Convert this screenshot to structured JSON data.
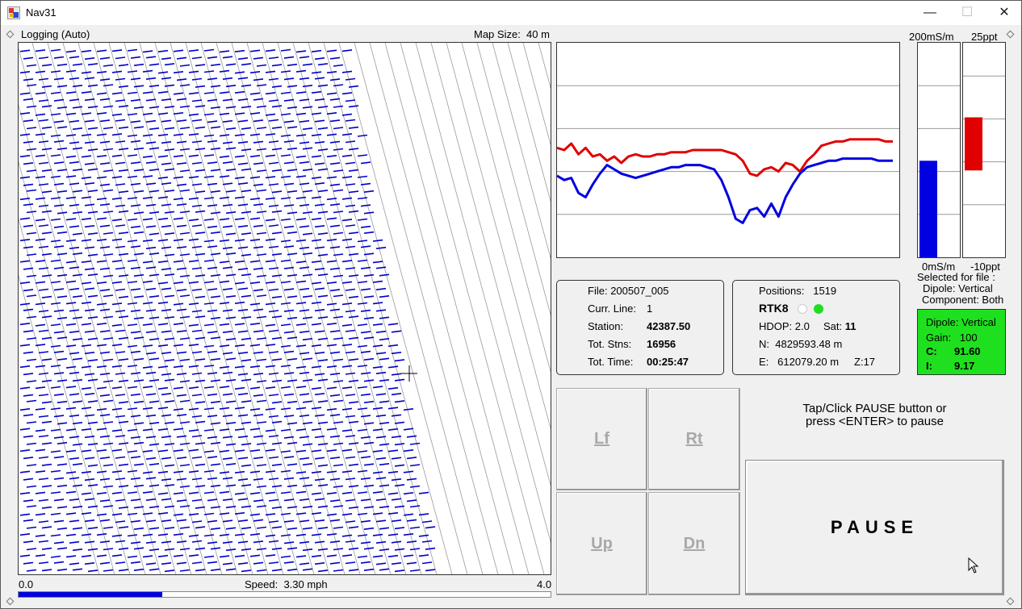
{
  "window": {
    "title": "Nav31",
    "icon": "nav31-app-icon",
    "min_icon": "minimize-icon",
    "max_icon": "maximize-icon",
    "close_icon": "close-icon"
  },
  "status": {
    "mode": "Logging (Auto)",
    "map_size_label": "Map Size:",
    "map_size_value": "40 m"
  },
  "speed": {
    "min": "0.0",
    "max": "4.0",
    "label": "Speed:",
    "value": "3.30 mph",
    "fraction": 0.27
  },
  "scales": {
    "conductivity_top": "200mS/m",
    "conductivity_bottom": "0mS/m",
    "inphase_top": "25ppt",
    "inphase_bottom": "-10ppt",
    "conductivity_level": 0.45,
    "inphase_range": [
      0.28,
      0.55
    ]
  },
  "selection": {
    "line1": "Selected for file :",
    "line2": "Dipole: Vertical",
    "line3": "Component: Both"
  },
  "file_panel": {
    "file_label": "File:",
    "file_value": "200507_005",
    "line_label": "Curr. Line:",
    "line_value": "1",
    "station_label": "Station:",
    "station_value": "42387.50",
    "stns_label": "Tot. Stns:",
    "stns_value": "16956",
    "time_label": "Tot. Time:",
    "time_value": "00:25:47"
  },
  "gps_panel": {
    "positions_label": "Positions:",
    "positions_value": "1519",
    "fix": "RTK8",
    "hdop_label": "HDOP:",
    "hdop_value": "2.0",
    "sat_label": "Sat:",
    "sat_value": "11",
    "n_label": "N:",
    "n_value": "4829593.48 m",
    "e_label": "E:",
    "e_value": "612079.20 m",
    "z_label": "Z:",
    "z_value": "17",
    "dot_colors": [
      "#ffffff",
      "#22dd22"
    ]
  },
  "dipole_panel": {
    "dipole": "Dipole: Vertical",
    "gain_label": "Gain:",
    "gain_value": "100",
    "c_label": "C:",
    "c_value": "91.60",
    "i_label": "I:",
    "i_value": "9.17",
    "color": "#1fe01f"
  },
  "nav_buttons": {
    "lf": "Lf",
    "rt": "Rt",
    "up": "Up",
    "dn": "Dn"
  },
  "instructions": {
    "line1": "Tap/Click PAUSE button or",
    "line2": "press <ENTER> to pause"
  },
  "pause_label": "PAUSE",
  "colors": {
    "track": "#0000c8",
    "red_series": "#e00000",
    "blue_series": "#0000e0",
    "speed_fill": "#0000e0"
  },
  "chart_data": {
    "type": "line",
    "series": [
      {
        "color": "red",
        "values": [
          0.49,
          0.5,
          0.47,
          0.52,
          0.49,
          0.53,
          0.52,
          0.55,
          0.53,
          0.56,
          0.53,
          0.52,
          0.53,
          0.53,
          0.52,
          0.52,
          0.51,
          0.51,
          0.51,
          0.5,
          0.5,
          0.5,
          0.5,
          0.5,
          0.51,
          0.52,
          0.55,
          0.61,
          0.62,
          0.59,
          0.58,
          0.6,
          0.56,
          0.57,
          0.6,
          0.55,
          0.52,
          0.48,
          0.47,
          0.46,
          0.46,
          0.45,
          0.45,
          0.45,
          0.45,
          0.45,
          0.46,
          0.46
        ]
      },
      {
        "color": "blue",
        "values": [
          0.62,
          0.64,
          0.63,
          0.7,
          0.72,
          0.66,
          0.61,
          0.57,
          0.59,
          0.61,
          0.62,
          0.63,
          0.62,
          0.61,
          0.6,
          0.59,
          0.58,
          0.58,
          0.57,
          0.57,
          0.57,
          0.58,
          0.59,
          0.64,
          0.72,
          0.82,
          0.84,
          0.78,
          0.77,
          0.81,
          0.75,
          0.81,
          0.72,
          0.66,
          0.61,
          0.58,
          0.57,
          0.56,
          0.55,
          0.55,
          0.54,
          0.54,
          0.54,
          0.54,
          0.54,
          0.55,
          0.55,
          0.55
        ]
      }
    ],
    "gridlines": 4
  }
}
